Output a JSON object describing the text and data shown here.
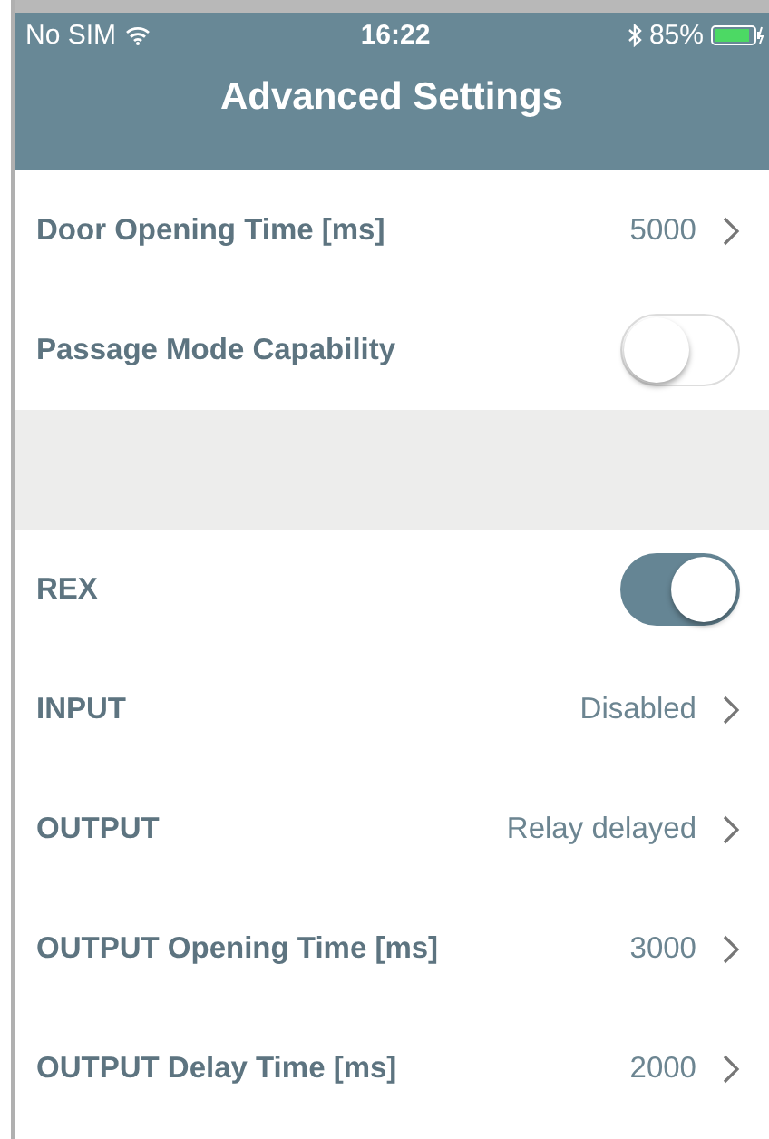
{
  "status_bar": {
    "carrier": "No SIM",
    "time": "16:22",
    "battery": "85%"
  },
  "nav_bar": {
    "title": "Advanced Settings"
  },
  "sections": [
    {
      "rows": [
        {
          "kind": "value",
          "label": "Door Opening Time [ms]",
          "value": "5000"
        },
        {
          "kind": "toggle",
          "label": "Passage Mode Capability",
          "on": false
        }
      ]
    },
    {
      "rows": [
        {
          "kind": "toggle",
          "label": "REX",
          "on": true
        },
        {
          "kind": "value",
          "label": "INPUT",
          "value": "Disabled"
        },
        {
          "kind": "value",
          "label": "OUTPUT",
          "value": "Relay delayed"
        },
        {
          "kind": "value",
          "label": "OUTPUT Opening Time [ms]",
          "value": "3000"
        },
        {
          "kind": "value",
          "label": "OUTPUT Delay Time [ms]",
          "value": "2000"
        }
      ]
    }
  ]
}
